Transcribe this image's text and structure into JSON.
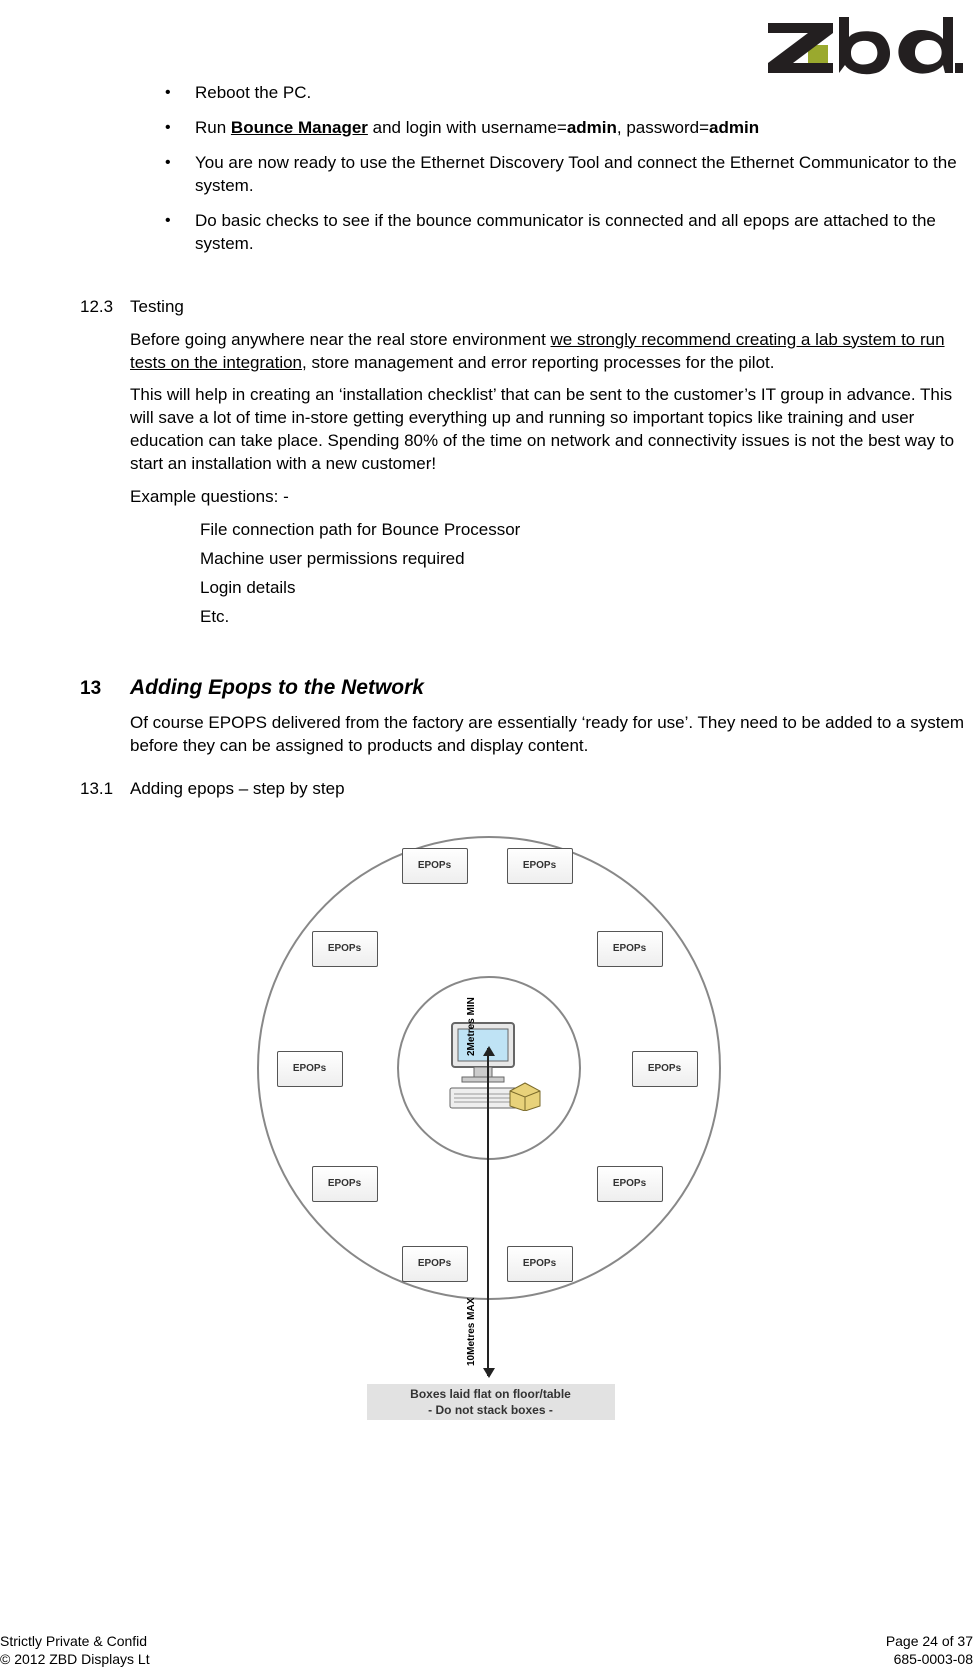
{
  "logo": {
    "alt": "zbd logo"
  },
  "bullets": [
    {
      "pre": "",
      "bold1": "",
      "mid": "Reboot the PC.",
      "bold2": "",
      "post": ""
    },
    {
      "pre": "Run ",
      "bold1": "Bounce Manager",
      "mid": " and login with username=",
      "bold2": "admin",
      "post": ", password=",
      "bold3": "admin"
    },
    {
      "pre": "",
      "bold1": "",
      "mid": "You are now ready to use the Ethernet Discovery Tool and connect the Ethernet Communicator to the system.",
      "bold2": "",
      "post": ""
    },
    {
      "pre": "",
      "bold1": "",
      "mid": "Do basic checks to see if the bounce communicator is connected and all epops are attached to the system.",
      "bold2": "",
      "post": ""
    }
  ],
  "section_testing": {
    "num": "12.3",
    "title": "Testing",
    "p1_a": "Before going anywhere near the real store environment ",
    "p1_u": "we strongly recommend creating a lab system to run tests on the integration",
    "p1_b": ", store management and error reporting processes for the pilot.",
    "p2": "This will help in creating an ‘installation checklist’ that can be sent to the customer’s IT group in advance. This will save a lot of time in-store getting everything up and running so important topics like training and user education can take place. Spending 80% of the time on network and connectivity issues is not the best way to start an installation with a new customer!",
    "p3": "Example questions: -",
    "items": [
      "File connection path for Bounce Processor",
      "Machine user permissions required",
      "Login details",
      "Etc."
    ]
  },
  "section_adding": {
    "num": "13",
    "title": "Adding Epops to the Network",
    "p1": "Of course EPOPS delivered from the factory are essentially ‘ready for use’. They need to be added to a system before they can be assigned to products and display content."
  },
  "section_steps": {
    "num": "13.1",
    "title": "Adding epops – step by step"
  },
  "diagram": {
    "box_label": "EPOPs",
    "min_label": "2Metres MIN",
    "max_label": "10Metres MAX",
    "caption1": "Boxes laid flat on floor/table",
    "caption2": "- Do not stack boxes -",
    "center_device": "bounce"
  },
  "footer": {
    "left1": "Strictly Private & Confid",
    "left2": "© 2012 ZBD Displays Lt",
    "right1": "Page 24 of 37",
    "right2": "685-0003-08"
  }
}
